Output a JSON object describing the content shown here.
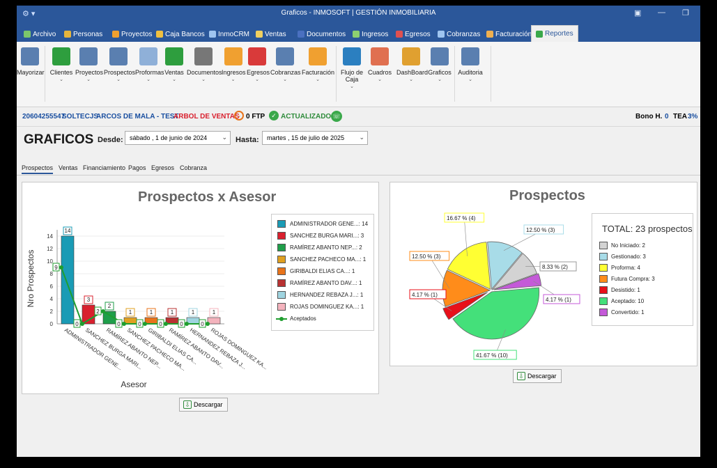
{
  "window": {
    "title": "Graficos - INMOSOFT | GESTIÓN INMOBILIARIA"
  },
  "menu_tabs": [
    {
      "label": "Archivo",
      "color": "#7cc66b"
    },
    {
      "label": "Personas",
      "color": "#e6b53d"
    },
    {
      "label": "Proyectos",
      "color": "#f0a030"
    },
    {
      "label": "Caja Bancos",
      "color": "#f0c040"
    },
    {
      "label": "InmoCRM",
      "color": "#9fc5f0"
    },
    {
      "label": "Ventas",
      "color": "#f0d060"
    },
    {
      "label": "Documentos",
      "color": "#4a70c0"
    },
    {
      "label": "Ingresos",
      "color": "#8dd070"
    },
    {
      "label": "Egresos",
      "color": "#e05050"
    },
    {
      "label": "Cobranzas",
      "color": "#9fc5f0"
    },
    {
      "label": "Facturación",
      "color": "#f0b050"
    },
    {
      "label": "Reportes",
      "color": "#3aa84a"
    }
  ],
  "ribbon": {
    "buttons": [
      {
        "label": "Mayorizar",
        "color": "#5a7fb0",
        "chevron": false
      },
      {
        "label": "Clientes",
        "color": "#2e9e3e",
        "chevron": true
      },
      {
        "label": "Proyectos",
        "color": "#5a7fb0",
        "chevron": true
      },
      {
        "label": "Prospectos",
        "color": "#5a7fb0",
        "chevron": true
      },
      {
        "label": "Proformas",
        "color": "#8fb0d8",
        "chevron": true
      },
      {
        "label": "Ventas",
        "color": "#2e9e3e",
        "chevron": true
      },
      {
        "label": "Documentos",
        "color": "#777777",
        "chevron": true
      },
      {
        "label": "Ingresos",
        "color": "#f0a030",
        "chevron": true
      },
      {
        "label": "Egresos",
        "color": "#d93a3a",
        "chevron": true
      },
      {
        "label": "Cobranzas",
        "color": "#5a7fb0",
        "chevron": true
      },
      {
        "label": "Facturación",
        "color": "#f0a030",
        "chevron": true
      },
      {
        "label": "Flujo de Caja",
        "color": "#2b7fc0",
        "chevron": true
      },
      {
        "label": "Cuadros",
        "color": "#e07050",
        "chevron": true
      },
      {
        "label": "DashBoard",
        "color": "#e0a030",
        "chevron": true
      },
      {
        "label": "Graficos",
        "color": "#5a7fb0",
        "chevron": true
      },
      {
        "label": "Auditoria",
        "color": "#5a7fb0",
        "chevron": true
      }
    ]
  },
  "status": {
    "ruc": "20604255547",
    "company": "SOLTECJS",
    "project": "ARCOS DE MALA - TEST",
    "arbol": "ARBOL DE VENTAS",
    "ftp": "0 FTP",
    "actualizado": "ACTUALIZADO",
    "bono_label": "Bono H.",
    "bono_value": "0",
    "tea_label": "TEA",
    "tea_value": "3%"
  },
  "page": {
    "title": "GRAFICOS",
    "desde_label": "Desde:",
    "desde_value": "sábado ,  1 de   junio   de 2024",
    "hasta_label": "Hasta:",
    "hasta_value": "martes , 15 de   julio   de 2025"
  },
  "subtabs": [
    "Prospectos",
    "Ventas",
    "Financiamiento",
    "Pagos",
    "Egresos",
    "Cobranza"
  ],
  "download_label": "Descargar",
  "chart_data": [
    {
      "type": "bar",
      "title": "Prospectos x Asesor",
      "xlabel": "Asesor",
      "ylabel": "Nro Prospectos",
      "ylim": [
        0,
        15
      ],
      "yticks": [
        "0",
        "2",
        "4",
        "6",
        "8",
        "10",
        "12",
        "14"
      ],
      "categories": [
        "ADMINISTRADOR GENE...",
        "SANCHEZ BURGA MARI...",
        "RAMÍREZ ABANTO NEP...",
        "SANCHEZ PACHECO MA...",
        "GIRIBALDI ELIAS CA...",
        "RAMÍREZ ABANTO DAV...",
        "HERNANDEZ REBAZA J...",
        "ROJAS DOMINGUEZ KA..."
      ],
      "series": [
        {
          "name": "Prospectos",
          "values": [
            14,
            3,
            2,
            1,
            1,
            1,
            1,
            1
          ],
          "colors": [
            "#1a9bb5",
            "#d9202e",
            "#1f9e4a",
            "#e0a020",
            "#e8731a",
            "#b83232",
            "#9fd4e0",
            "#f4b3bd"
          ]
        },
        {
          "name": "Aceptados",
          "values": [
            9,
            0,
            2,
            0,
            0,
            0,
            0,
            0
          ],
          "color": "#1f9e2f"
        }
      ],
      "legend": [
        {
          "label": "ADMINISTRADOR GENE...: 14",
          "color": "#1a9bb5"
        },
        {
          "label": "SANCHEZ BURGA MARI...: 3",
          "color": "#d9202e"
        },
        {
          "label": "RAMÍREZ ABANTO NEP...: 2",
          "color": "#1f9e4a"
        },
        {
          "label": "SANCHEZ PACHECO MA...: 1",
          "color": "#e0a020"
        },
        {
          "label": "GIRIBALDI ELIAS CA...: 1",
          "color": "#e8731a"
        },
        {
          "label": "RAMÍREZ ABANTO DAV...: 1",
          "color": "#b83232"
        },
        {
          "label": "HERNANDEZ REBAZA J...: 1",
          "color": "#9fd4e0"
        },
        {
          "label": "ROJAS DOMINGUEZ KA...: 1",
          "color": "#f4b3bd"
        },
        {
          "label": "Aceptados",
          "color": "#1f9e2f"
        }
      ],
      "legend_position": "right"
    },
    {
      "type": "pie",
      "title": "Prospectos",
      "total_label": "TOTAL: 23 prospectos",
      "slices": [
        {
          "name": "No Iniciado",
          "value": 2,
          "pct_label": "8.33 % (2)",
          "legend": "No Iniciado: 2",
          "color": "#d3d3d3"
        },
        {
          "name": "Gestionado",
          "value": 3,
          "pct_label": "12.50 % (3)",
          "legend": "Gestionado: 3",
          "color": "#a8dce8"
        },
        {
          "name": "Proforma",
          "value": 4,
          "pct_label": "16.67 % (4)",
          "legend": "Proforma: 4",
          "color": "#ffff33"
        },
        {
          "name": "Futura Compra",
          "value": 3,
          "pct_label": "12.50 % (3)",
          "legend": "Futura Compra: 3",
          "color": "#ff8c1a"
        },
        {
          "name": "Desistido",
          "value": 1,
          "pct_label": "4.17 % (1)",
          "legend": "Desistido: 1",
          "color": "#e8101a"
        },
        {
          "name": "Aceptado",
          "value": 10,
          "pct_label": "41.67 % (10)",
          "legend": "Aceptado: 10",
          "color": "#44e07a"
        },
        {
          "name": "Convertido",
          "value": 1,
          "pct_label": "4.17 % (1)",
          "legend": "Convertido: 1",
          "color": "#c45ad8"
        }
      ],
      "legend_position": "right"
    }
  ]
}
